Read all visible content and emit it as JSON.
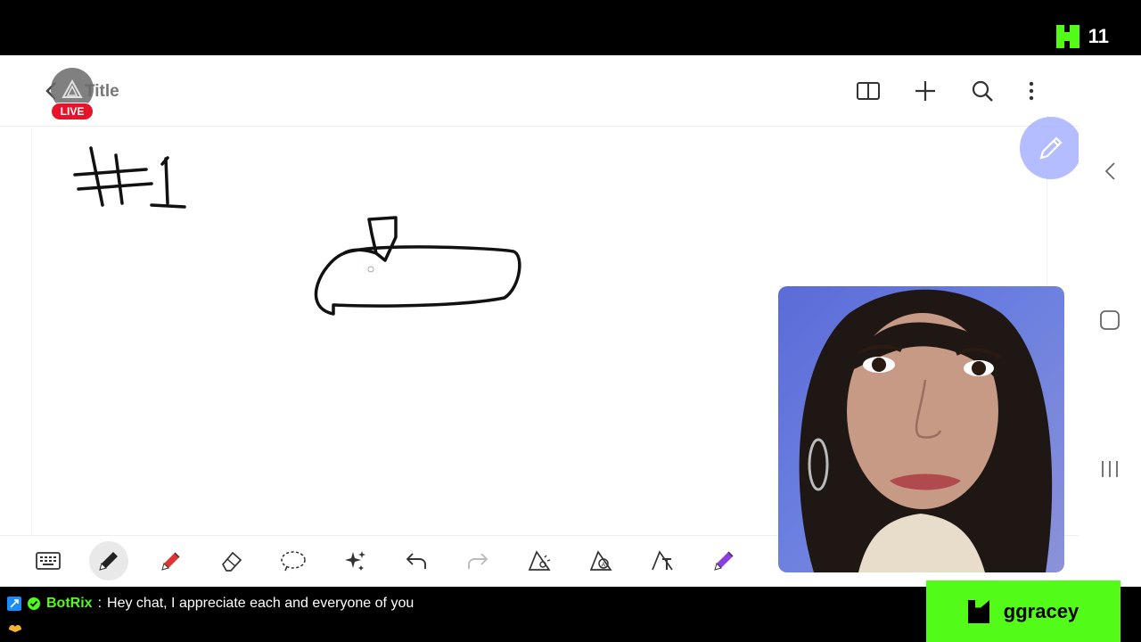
{
  "stream": {
    "viewer_count": "11",
    "live_label": "LIVE",
    "channel_name": "ggracey"
  },
  "note": {
    "title": "Title"
  },
  "drawing": {
    "label": "#1"
  },
  "header": {
    "icons": [
      "book-icon",
      "plus-icon",
      "search-icon",
      "more-vert-icon"
    ]
  },
  "toolbar": {
    "tools": [
      "keyboard-icon",
      "pen-icon",
      "highlighter-icon",
      "eraser-icon",
      "lasso-icon",
      "ai-sparkle-icon",
      "undo-icon",
      "redo-icon",
      "shape-pen-icon",
      "shape-pen-2-icon",
      "text-pen-icon",
      "marker-purple-icon"
    ]
  },
  "chat": {
    "username": "BotRix",
    "separator": ":",
    "message": "Hey chat, I appreciate each and everyone of you"
  },
  "colors": {
    "kick_green": "#53fc18",
    "live_red": "#e4152b",
    "fab_purple": "#a8b2ff"
  }
}
